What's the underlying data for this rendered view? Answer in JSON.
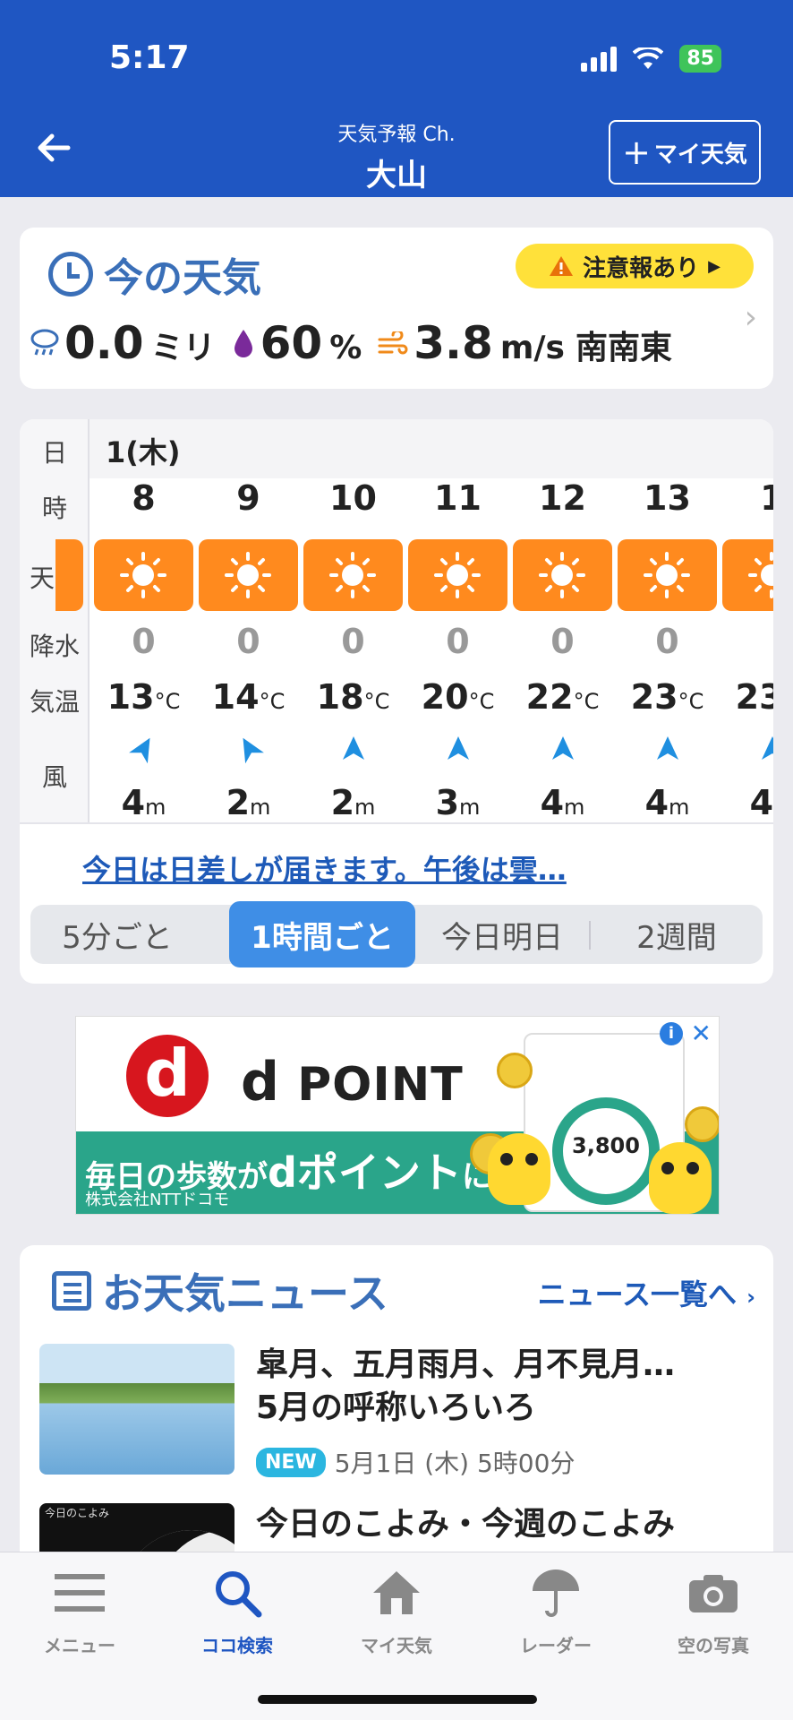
{
  "status_bar": {
    "time": "5:17",
    "battery": "85"
  },
  "nav": {
    "subtitle": "天気予報 Ch.",
    "title": "大山",
    "my_button": "マイ天気",
    "my_button_plus": "+"
  },
  "current": {
    "title": "今の天気",
    "alert": "注意報あり",
    "precip_value": "0.0",
    "precip_unit": "ミリ",
    "humidity_value": "60",
    "humidity_unit": "%",
    "wind_value": "3.8",
    "wind_unit": "m/s",
    "wind_dir": "南南東"
  },
  "hourly": {
    "row_labels": {
      "day": "日",
      "hour": "時",
      "weather": "天気",
      "precip": "降水",
      "temp": "気温",
      "wind": "風"
    },
    "day": "1(木)",
    "temp_unit": "°C",
    "wind_unit": "m",
    "hours": [
      {
        "hour": "8",
        "precip": "0",
        "temp": "13",
        "wind": "4",
        "dir_deg": 30
      },
      {
        "hour": "9",
        "precip": "0",
        "temp": "14",
        "wind": "2",
        "dir_deg": -30
      },
      {
        "hour": "10",
        "precip": "0",
        "temp": "18",
        "wind": "2",
        "dir_deg": 0
      },
      {
        "hour": "11",
        "precip": "0",
        "temp": "20",
        "wind": "3",
        "dir_deg": 0
      },
      {
        "hour": "12",
        "precip": "0",
        "temp": "22",
        "wind": "4",
        "dir_deg": 0
      },
      {
        "hour": "13",
        "precip": "0",
        "temp": "23",
        "wind": "4",
        "dir_deg": 0
      },
      {
        "hour": "1",
        "precip": "",
        "temp": "23",
        "wind": "4",
        "dir_deg": 0
      }
    ],
    "summary_link": "今日は日差しが届きます。午後は雲…",
    "tabs": [
      "5分ごと",
      "1時間ごと",
      "今日明日",
      "2週間"
    ]
  },
  "ad": {
    "brand": "POINT",
    "tagline_pre": "毎日の歩数が",
    "tagline_brand": "dポイント",
    "tagline_post": "に!",
    "company": "株式会社NTTドコモ",
    "steps": "3,800"
  },
  "news": {
    "title": "お天気ニュース",
    "all_link": "ニュース一覧へ",
    "items": [
      {
        "title_line1": "皐月、五月雨月、月不見月…",
        "title_line2": "5月の呼称いろいろ",
        "badge": "NEW",
        "date": "5月1日 (木) 5時00分"
      },
      {
        "title_line1": "今日のこよみ・今週のこよみ",
        "thumb_label": "今日のこよみ"
      }
    ]
  },
  "tabbar": {
    "items": [
      "メニュー",
      "ココ検索",
      "マイ天気",
      "レーダー",
      "空の写真"
    ]
  },
  "colors": {
    "header": "#1f56c2",
    "sunny_bg": "#ff8a1e",
    "link": "#1e5ab8",
    "accent": "#3f8ee6"
  }
}
